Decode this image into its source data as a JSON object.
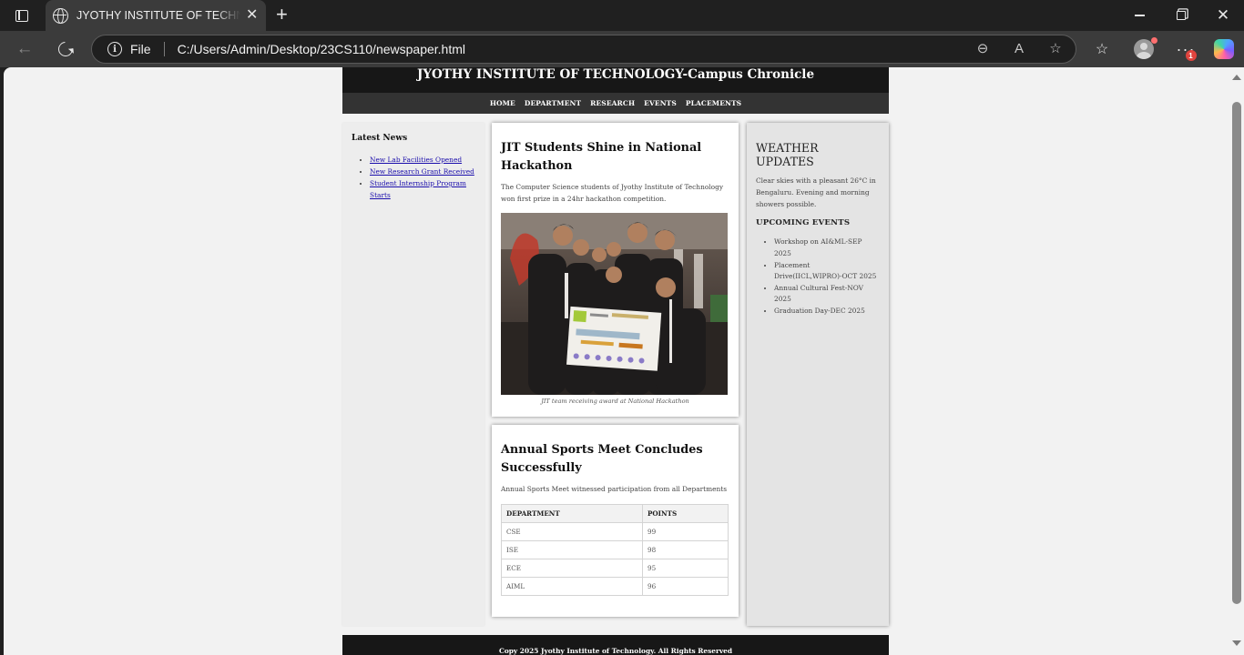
{
  "browser": {
    "tab_title": "JYOTHY INSTITUTE OF TECHNOLOGY-Campus Chronicle",
    "address_prefix": "File",
    "url": "C:/Users/Admin/Desktop/23CS110/newspaper.html",
    "notification_count": "1"
  },
  "site": {
    "title": "JYOTHY INSTITUTE OF TECHNOLOGY-Campus Chronicle",
    "nav": [
      "HOME",
      "DEPARTMENT",
      "RESEARCH",
      "EVENTS",
      "PLACEMENTS"
    ],
    "latest_news": {
      "heading": "Latest News",
      "items": [
        "New Lab Facilities Opened",
        "New Research Grant Received",
        "Student Internship Program Starts"
      ]
    },
    "article1": {
      "headline": "JIT Students Shine in National Hackathon",
      "body": "The Computer Science students of Jyothy Institute of Technology won first prize in a 24hr hackathon competition.",
      "caption": "JIT team receiving award at National Hackathon"
    },
    "article2": {
      "headline": "Annual Sports Meet Concludes Successfully",
      "body": "Annual Sports Meet witnessed participation from all Departments",
      "table": {
        "headers": [
          "DEPARTMENT",
          "POINTS"
        ],
        "rows": [
          [
            "CSE",
            "99"
          ],
          [
            "ISE",
            "98"
          ],
          [
            "ECE",
            "95"
          ],
          [
            "AIML",
            "96"
          ]
        ]
      }
    },
    "weather": {
      "heading": "WEATHER UPDATES",
      "text": "Clear skies with a pleasant 26°C in Bengaluru. Evening and morning showers possible."
    },
    "events": {
      "heading": "UPCOMING EVENTS",
      "items": [
        "Workshop on AI&ML-SEP 2025",
        "Placement Drive(IICL,WIPRO)-OCT 2025",
        "Annual Cultural Fest-NOV 2025",
        "Graduation Day-DEC 2025"
      ]
    },
    "footer": "Copy 2025 Jyothy Institute of Technology. All Rights Reserved"
  }
}
